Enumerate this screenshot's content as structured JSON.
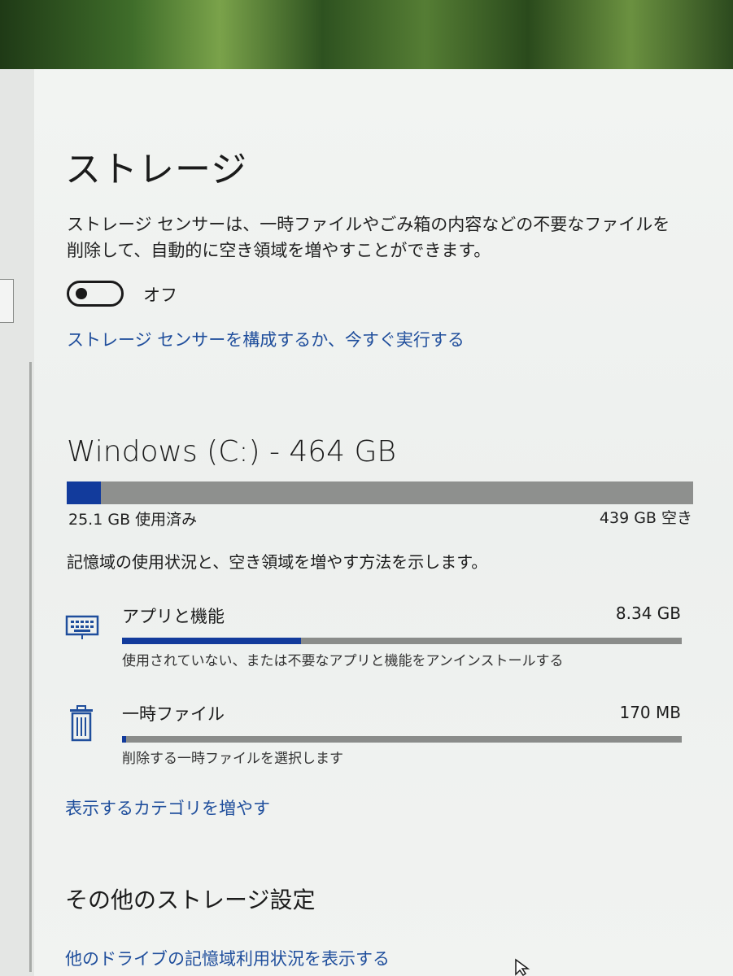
{
  "header": {
    "title": "ストレージ"
  },
  "storage_sense": {
    "description": "ストレージ センサーは、一時ファイルやごみ箱の内容などの不要なファイルを削除して、自動的に空き領域を増やすことができます。",
    "toggle_state": "オフ",
    "toggle_on": false,
    "configure_link": "ストレージ センサーを構成するか、今すぐ実行する"
  },
  "drive": {
    "title": "Windows (C:) - 464 GB",
    "used_label": "25.1 GB 使用済み",
    "free_label": "439 GB 空き",
    "used_fraction": 0.054,
    "bar_color": "#123b9c"
  },
  "usage": {
    "description": "記憶域の使用状況と、空き領域を増やす方法を示します。",
    "categories": [
      {
        "icon": "keyboard-icon",
        "label": "アプリと機能",
        "size": "8.34 GB",
        "subtext": "使用されていない、または不要なアプリと機能をアンインストールする",
        "fraction": 0.32
      },
      {
        "icon": "trash-icon",
        "label": "一時ファイル",
        "size": "170 MB",
        "subtext": "削除する一時ファイルを選択します",
        "fraction": 0.007
      }
    ],
    "more_categories_link": "表示するカテゴリを増やす"
  },
  "other_settings": {
    "title": "その他のストレージ設定",
    "link": "他のドライブの記憶域利用状況を表示する"
  },
  "colors": {
    "accent": "#123b9c",
    "link": "#1f4e9c",
    "bar_bg": "#8e908e"
  }
}
